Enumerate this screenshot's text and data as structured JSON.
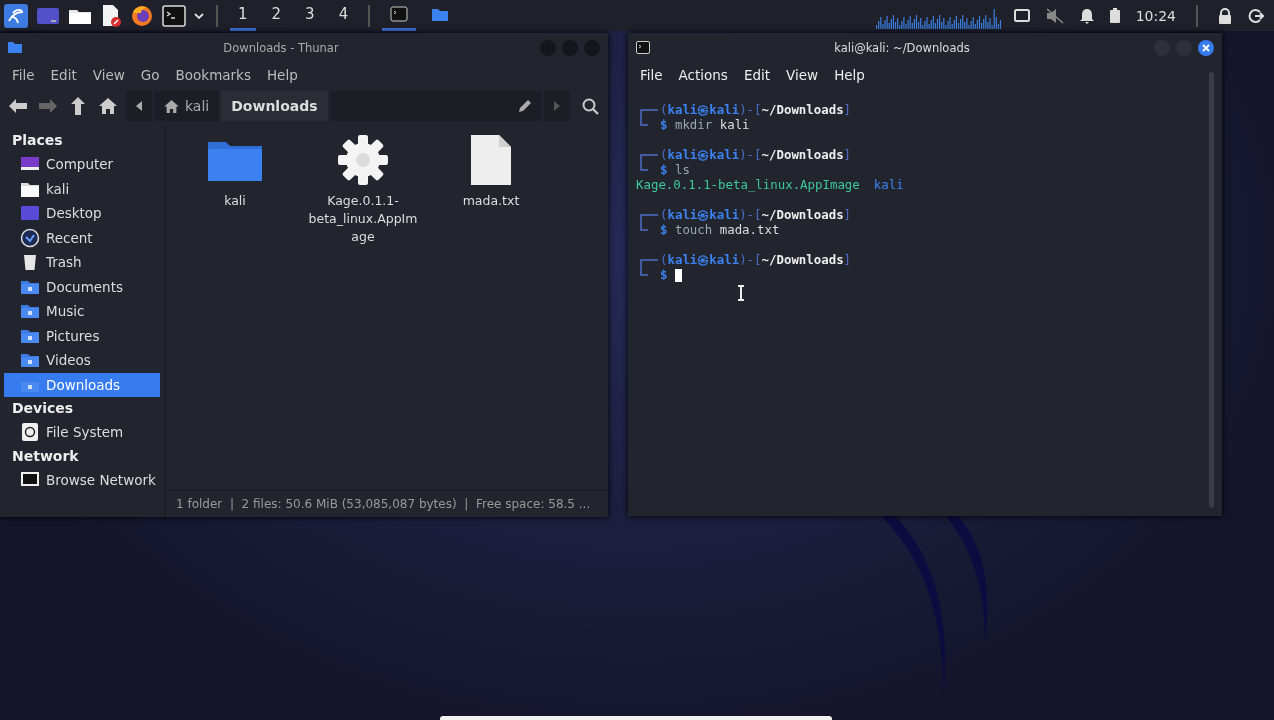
{
  "taskbar": {
    "launchers": [
      {
        "kind": "kali"
      },
      {
        "kind": "desktop"
      },
      {
        "kind": "files"
      },
      {
        "kind": "editor"
      },
      {
        "kind": "browser"
      },
      {
        "kind": "terminal"
      },
      {
        "kind": "dropdown"
      }
    ],
    "workspaces": [
      {
        "label": "1",
        "selected": true
      },
      {
        "label": "2",
        "selected": false
      },
      {
        "label": "3",
        "selected": false
      },
      {
        "label": "4",
        "selected": false
      }
    ],
    "tasks": [
      {
        "kind": "terminal",
        "selected": true
      },
      {
        "kind": "files",
        "selected": false
      }
    ],
    "tray": {
      "muted": true,
      "time": "10:24"
    }
  },
  "thunar": {
    "title": "Downloads - Thunar",
    "menu": [
      "File",
      "Edit",
      "View",
      "Go",
      "Bookmarks",
      "Help"
    ],
    "path": [
      {
        "label": "kali",
        "kind": "home",
        "selected": false
      },
      {
        "label": "Downloads",
        "kind": "folder",
        "selected": true
      }
    ],
    "sidebar": [
      {
        "title": "Places",
        "items": [
          {
            "label": "Computer",
            "kind": "computer",
            "selected": false
          },
          {
            "label": "kali",
            "kind": "home",
            "selected": false
          },
          {
            "label": "Desktop",
            "kind": "desktop",
            "selected": false
          },
          {
            "label": "Recent",
            "kind": "recent",
            "selected": false
          },
          {
            "label": "Trash",
            "kind": "trash",
            "selected": false
          },
          {
            "label": "Documents",
            "kind": "folder",
            "selected": false
          },
          {
            "label": "Music",
            "kind": "folder",
            "selected": false
          },
          {
            "label": "Pictures",
            "kind": "folder",
            "selected": false
          },
          {
            "label": "Videos",
            "kind": "folder",
            "selected": false
          },
          {
            "label": "Downloads",
            "kind": "folder",
            "selected": true
          }
        ]
      },
      {
        "title": "Devices",
        "items": [
          {
            "label": "File System",
            "kind": "drive",
            "selected": false
          }
        ]
      },
      {
        "title": "Network",
        "items": [
          {
            "label": "Browse Network",
            "kind": "network",
            "selected": false
          }
        ]
      }
    ],
    "files": [
      {
        "name": "kali",
        "kind": "folder"
      },
      {
        "name": "Kage.0.1.1-beta_linux.AppImage",
        "kind": "executable"
      },
      {
        "name": "mada.txt",
        "kind": "text"
      }
    ],
    "status": "1 folder  |  2 files: 50.6 MiB (53,085,087 bytes)  |  Free space: 58.5 ..."
  },
  "terminal": {
    "title": "kali@kali: ~/Downloads",
    "menu": [
      "File",
      "Actions",
      "Edit",
      "View",
      "Help"
    ],
    "blocks": [
      {
        "prompt": {
          "open": "(",
          "user": "kali㉿kali",
          "mid": ")-[",
          "dir": "~/Downloads",
          "close": "]"
        },
        "sign": "$",
        "command": "mkdir",
        "args": "kali"
      },
      {
        "prompt": {
          "open": "(",
          "user": "kali㉿kali",
          "mid": ")-[",
          "dir": "~/Downloads",
          "close": "]"
        },
        "sign": "$",
        "command": "ls",
        "output": [
          {
            "text": "Kage.0.1.1-beta_linux.AppImage",
            "color": "#3ec99a"
          },
          {
            "text": "kali",
            "color": "#3b82f0"
          }
        ]
      },
      {
        "prompt": {
          "open": "(",
          "user": "kali㉿kali",
          "mid": ")-[",
          "dir": "~/Downloads",
          "close": "]"
        },
        "sign": "$",
        "command": "touch",
        "args": "mada.txt"
      },
      {
        "prompt": {
          "open": "(",
          "user": "kali㉿kali",
          "mid": ")-[",
          "dir": "~/Downloads",
          "close": "]"
        },
        "sign": "$",
        "cursor": true
      }
    ]
  }
}
